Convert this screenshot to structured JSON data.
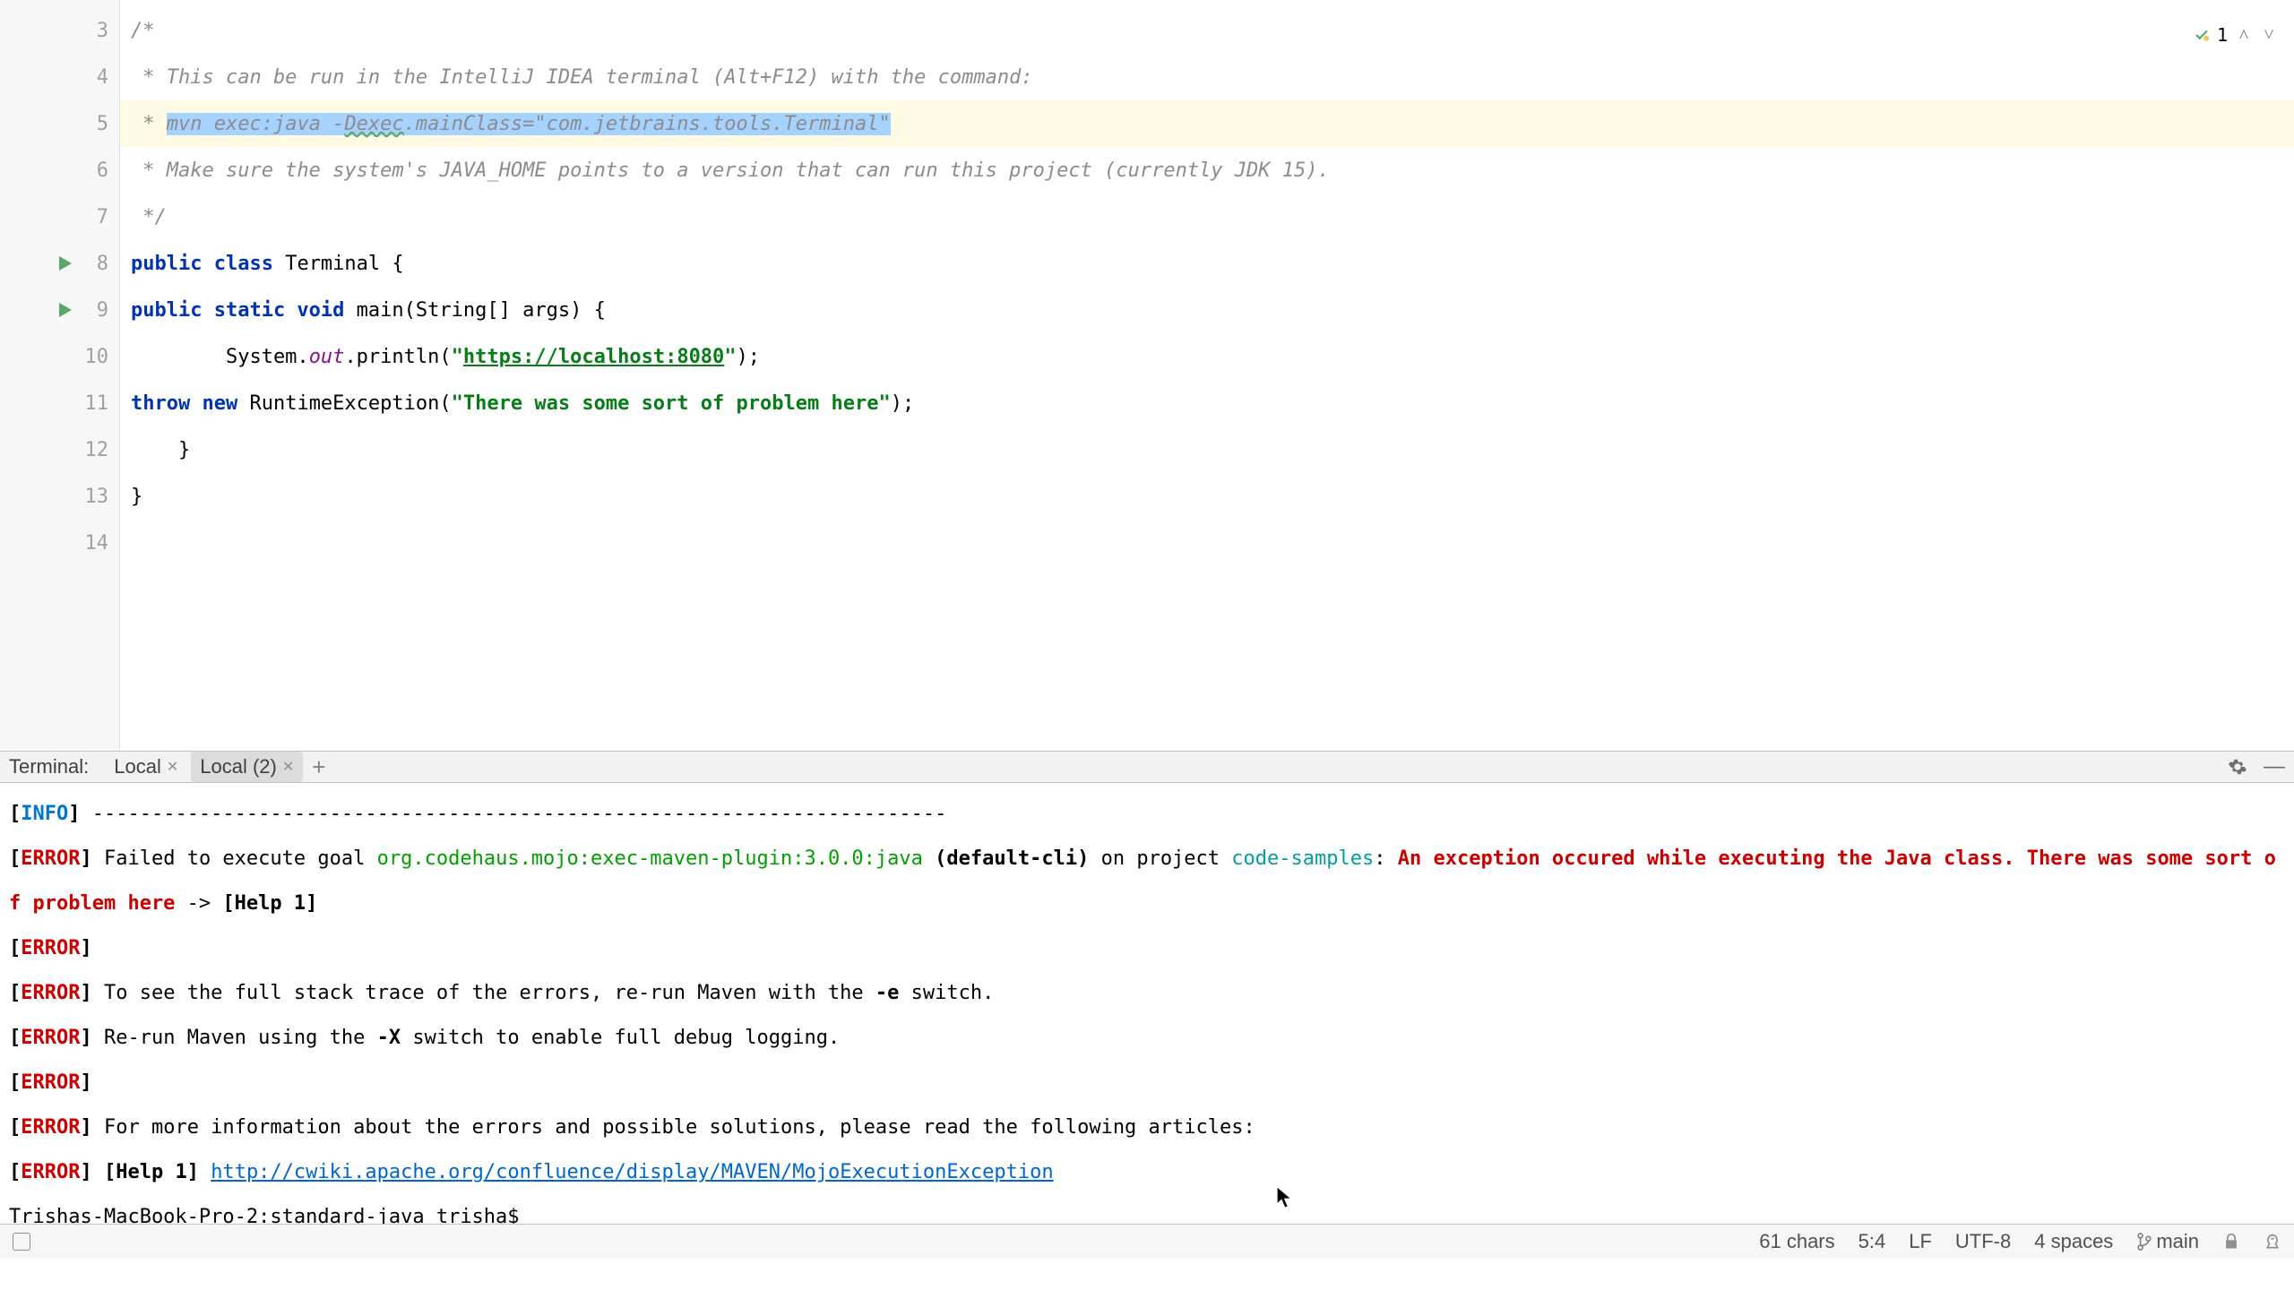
{
  "editor": {
    "lines": [
      {
        "n": 3,
        "type": "comment",
        "text": "/*"
      },
      {
        "n": 4,
        "type": "comment",
        "text": " * This can be run in the IntelliJ IDEA terminal (Alt+F12) with the command:"
      },
      {
        "n": 5,
        "type": "comment-sel",
        "prefix": " * ",
        "sel": "mvn exec:java -Dexec.mainClass=\"com.jetbrains.tools.Terminal\"",
        "wavy": "Dexec"
      },
      {
        "n": 6,
        "type": "comment",
        "text": " * Make sure the system's JAVA_HOME points to a version that can run this project (currently JDK 15)."
      },
      {
        "n": 7,
        "type": "comment",
        "text": " */"
      },
      {
        "n": 8,
        "type": "class",
        "kw1": "public class",
        "name": " Terminal {",
        "runnable": true
      },
      {
        "n": 9,
        "type": "method",
        "indent": "    ",
        "kw": "public static void",
        "name": " main(String[] args) {",
        "runnable": true
      },
      {
        "n": 10,
        "type": "println",
        "indent": "        ",
        "pre": "System.",
        "field": "out",
        "mid": ".println(\"",
        "url": "https://localhost:8080",
        "post": "\");"
      },
      {
        "n": 11,
        "type": "throw",
        "indent": "        ",
        "kw": "throw new",
        "mid": " RuntimeException(",
        "str": "\"There was some sort of problem here\"",
        "post": ");"
      },
      {
        "n": 12,
        "type": "plain",
        "text": "    }"
      },
      {
        "n": 13,
        "type": "plain",
        "text": "}"
      },
      {
        "n": 14,
        "type": "plain",
        "text": ""
      }
    ],
    "inspection": {
      "count": "1"
    }
  },
  "terminal_panel": {
    "label": "Terminal:",
    "tabs": [
      {
        "name": "Local"
      },
      {
        "name": "Local (2)",
        "active": true
      }
    ]
  },
  "terminal": {
    "lines": [
      {
        "segs": [
          [
            "br",
            "["
          ],
          [
            "t-info",
            "INFO"
          ],
          [
            "br",
            "]"
          ],
          [
            "",
            " ------------------------------------------------------------------------"
          ]
        ]
      },
      {
        "segs": [
          [
            "br",
            "["
          ],
          [
            "t-err",
            "ERROR"
          ],
          [
            "br",
            "]"
          ],
          [
            "",
            " Failed to execute goal "
          ],
          [
            "t-green",
            "org.codehaus.mojo:exec-maven-plugin:3.0.0:java"
          ],
          [
            "",
            " "
          ],
          [
            "br",
            "(default-cli)"
          ],
          [
            "",
            " on project "
          ],
          [
            "t-cyan",
            "code-samples"
          ],
          [
            "",
            ": "
          ],
          [
            "t-red2",
            "An exception occured while executing the Java class. There was some sort of problem here"
          ],
          [
            "",
            " -> "
          ],
          [
            "br",
            "[Help 1]"
          ]
        ]
      },
      {
        "segs": [
          [
            "br",
            "["
          ],
          [
            "t-err",
            "ERROR"
          ],
          [
            "br",
            "]"
          ]
        ]
      },
      {
        "segs": [
          [
            "br",
            "["
          ],
          [
            "t-err",
            "ERROR"
          ],
          [
            "br",
            "]"
          ],
          [
            "",
            " To see the full stack trace of the errors, re-run Maven with the "
          ],
          [
            "br",
            "-e"
          ],
          [
            "",
            " switch."
          ]
        ]
      },
      {
        "segs": [
          [
            "br",
            "["
          ],
          [
            "t-err",
            "ERROR"
          ],
          [
            "br",
            "]"
          ],
          [
            "",
            " Re-run Maven using the "
          ],
          [
            "br",
            "-X"
          ],
          [
            "",
            " switch to enable full debug logging."
          ]
        ]
      },
      {
        "segs": [
          [
            "br",
            "["
          ],
          [
            "t-err",
            "ERROR"
          ],
          [
            "br",
            "]"
          ]
        ]
      },
      {
        "segs": [
          [
            "br",
            "["
          ],
          [
            "t-err",
            "ERROR"
          ],
          [
            "br",
            "]"
          ],
          [
            "",
            " For more information about the errors and possible solutions, please read the following articles:"
          ]
        ]
      },
      {
        "segs": [
          [
            "br",
            "["
          ],
          [
            "t-err",
            "ERROR"
          ],
          [
            "br",
            "]"
          ],
          [
            "",
            " "
          ],
          [
            "br",
            "[Help 1]"
          ],
          [
            "",
            " "
          ],
          [
            "t-link",
            "http://cwiki.apache.org/confluence/display/MAVEN/MojoExecutionException"
          ]
        ]
      },
      {
        "segs": [
          [
            "",
            "Trishas-MacBook-Pro-2:standard-java trisha$ "
          ]
        ]
      }
    ]
  },
  "status": {
    "chars": "61 chars",
    "pos": "5:4",
    "eol": "LF",
    "enc": "UTF-8",
    "indent": "4 spaces",
    "branch": "main"
  }
}
